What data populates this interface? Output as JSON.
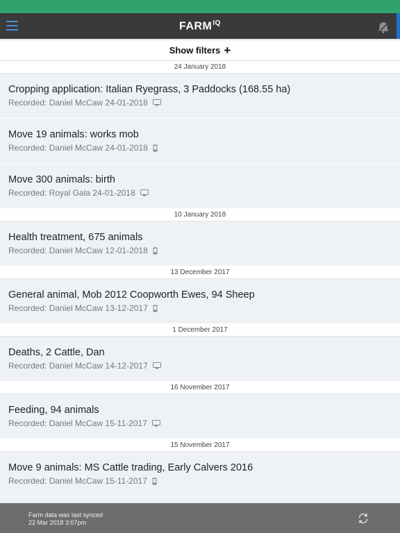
{
  "app": {
    "logo_main": "FARM",
    "logo_suffix": "IQ",
    "colors": {
      "status_bar": "#2fa36a",
      "header": "#3a3a3a",
      "accent": "#1e6fd0",
      "footer": "#6d6d6d"
    },
    "icons": {
      "menu": "hamburger-icon",
      "alerts": "bell-icon",
      "sync": "refresh-icon"
    }
  },
  "filters": {
    "label": "Show filters",
    "plus": "+"
  },
  "groups": [
    {
      "date": "24 January 2018",
      "events": [
        {
          "title": "Cropping application: Italian Ryegrass, 3 Paddocks (168.55 ha)",
          "recorded": "Recorded: Daniel McCaw 24-01-2018",
          "device": "desktop"
        },
        {
          "title": "Move 19 animals: works mob",
          "recorded": "Recorded: Daniel McCaw 24-01-2018",
          "device": "mobile"
        },
        {
          "title": "Move 300 animals: birth",
          "recorded": "Recorded: Royal Gala 24-01-2018",
          "device": "desktop"
        }
      ]
    },
    {
      "date": "10 January 2018",
      "events": [
        {
          "title": "Health treatment, 675 animals",
          "recorded": "Recorded: Daniel McCaw 12-01-2018",
          "device": "mobile"
        }
      ]
    },
    {
      "date": "13 December 2017",
      "events": [
        {
          "title": "General animal, Mob 2012 Coopworth Ewes, 94 Sheep",
          "recorded": "Recorded: Daniel McCaw 13-12-2017",
          "device": "mobile"
        }
      ]
    },
    {
      "date": "1 December 2017",
      "events": [
        {
          "title": "Deaths, 2 Cattle, Dan",
          "recorded": "Recorded: Daniel McCaw 14-12-2017",
          "device": "desktop"
        }
      ]
    },
    {
      "date": "16 November 2017",
      "events": [
        {
          "title": "Feeding, 94 animals",
          "recorded": "Recorded: Daniel McCaw 15-11-2017",
          "device": "desktop"
        }
      ]
    },
    {
      "date": "15 November 2017",
      "events": [
        {
          "title": "Move 9 animals: MS Cattle trading, Early Calvers 2016",
          "recorded": "Recorded: Daniel McCaw 15-11-2017",
          "device": "mobile"
        }
      ]
    }
  ],
  "footer": {
    "line1": "Farm data was last synced",
    "line2": "22 Mar 2018 3:07pm"
  }
}
